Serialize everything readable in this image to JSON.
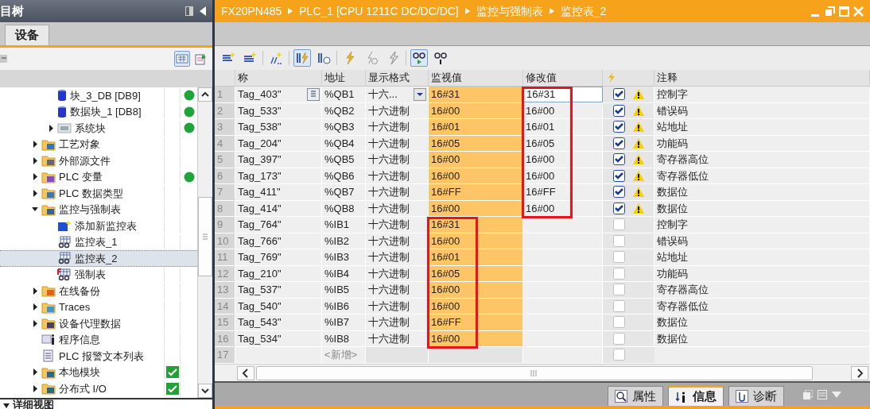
{
  "project_tree": {
    "title": "目树",
    "tab": "设备",
    "toolbar": [
      {
        "kind": "grid-view",
        "pressed": true
      },
      {
        "kind": "export",
        "pressed": false
      }
    ],
    "items": [
      {
        "kind": "hidden-parent",
        "children": [
          {
            "label": "块_3_DB [DB9]",
            "kind": "db",
            "selected": false,
            "online": true
          },
          {
            "label": "数据块_1 [DB8]",
            "kind": "db",
            "selected": false,
            "online": true
          },
          {
            "label": "系统块",
            "kind": "system",
            "expanded": false,
            "selected": false,
            "online": true
          }
        ]
      },
      {
        "label": "工艺对象",
        "kind": "folder-tech",
        "expanded": false,
        "selected": false
      },
      {
        "label": "外部源文件",
        "kind": "folder-source",
        "expanded": false,
        "selected": false
      },
      {
        "label": "PLC 变量",
        "kind": "folder-tags",
        "expanded": false,
        "selected": false,
        "online": true
      },
      {
        "label": "PLC 数据类型",
        "kind": "folder-types",
        "expanded": false,
        "selected": false
      },
      {
        "label": "监控与强制表",
        "kind": "folder-watch",
        "expanded": true,
        "selected": false,
        "children": [
          {
            "label": "添加新监控表",
            "kind": "add",
            "selected": false
          },
          {
            "label": "监控表_1",
            "kind": "watch",
            "selected": false
          },
          {
            "label": "监控表_2",
            "kind": "watch",
            "selected": true
          },
          {
            "label": "强制表",
            "kind": "force",
            "selected": false
          }
        ]
      },
      {
        "label": "在线备份",
        "kind": "folder-backup",
        "expanded": false,
        "selected": false
      },
      {
        "label": "Traces",
        "kind": "folder-trace",
        "expanded": false,
        "selected": false
      },
      {
        "label": "设备代理数据",
        "kind": "folder-proxy",
        "expanded": false,
        "selected": false
      },
      {
        "label": "程序信息",
        "kind": "info",
        "selected": false
      },
      {
        "label": "PLC 报警文本列表",
        "kind": "textlist",
        "selected": false
      },
      {
        "label": "本地模块",
        "kind": "folder-module",
        "expanded": false,
        "selected": false,
        "ok": true
      },
      {
        "label": "分布式 I/O",
        "kind": "folder-module",
        "expanded": false,
        "selected": false,
        "ok": true
      }
    ],
    "detail_view": "详细视图"
  },
  "editor": {
    "breadcrumb": [
      "FX20PN485",
      "PLC_1 [CPU 1211C DC/DC/DC]",
      "监控与强制表",
      "监控表_2"
    ],
    "toolbar": [
      {
        "kind": "insert-row",
        "pressed": false
      },
      {
        "kind": "add-row",
        "pressed": false
      },
      {
        "kind": "multi-row",
        "pressed": false
      },
      {
        "kind": "show-modify",
        "pressed": true
      },
      {
        "kind": "show-trigger",
        "pressed": false
      },
      {
        "kind": "modify-now",
        "pressed": false
      },
      {
        "kind": "modify-trigger",
        "pressed": false
      },
      {
        "kind": "enable-output",
        "pressed": false
      },
      {
        "kind": "monitor-all",
        "pressed": true
      },
      {
        "kind": "monitor-once",
        "pressed": false
      }
    ],
    "columns": [
      "称",
      "地址",
      "显示格式",
      "监视值",
      "修改值",
      "注释"
    ],
    "rows": [
      {
        "no": "1",
        "name": "Tag_403\"",
        "address": "%QB1",
        "format": "十六...",
        "monitor": "16#31",
        "modify": "16#31",
        "editing": true,
        "checked": true,
        "warning": true,
        "comment": "控制字",
        "monitor_framed": false,
        "modify_framed": true
      },
      {
        "no": "2",
        "name": "Tag_533\"",
        "address": "%QB2",
        "format": "十六进制",
        "monitor": "16#00",
        "modify": "16#00",
        "checked": true,
        "warning": true,
        "comment": "错误码",
        "monitor_framed": false,
        "modify_framed": true
      },
      {
        "no": "3",
        "name": "Tag_538\"",
        "address": "%QB3",
        "format": "十六进制",
        "monitor": "16#01",
        "modify": "16#01",
        "checked": true,
        "warning": true,
        "comment": "站地址",
        "monitor_framed": false,
        "modify_framed": true
      },
      {
        "no": "4",
        "name": "Tag_204\"",
        "address": "%QB4",
        "format": "十六进制",
        "monitor": "16#05",
        "modify": "16#05",
        "checked": true,
        "warning": true,
        "comment": "功能码",
        "monitor_framed": false,
        "modify_framed": true
      },
      {
        "no": "5",
        "name": "Tag_397\"",
        "address": "%QB5",
        "format": "十六进制",
        "monitor": "16#00",
        "modify": "16#00",
        "checked": true,
        "warning": true,
        "comment": "寄存器高位",
        "monitor_framed": false,
        "modify_framed": true
      },
      {
        "no": "6",
        "name": "Tag_173\"",
        "address": "%QB6",
        "format": "十六进制",
        "monitor": "16#00",
        "modify": "16#00",
        "checked": true,
        "warning": true,
        "comment": "寄存器低位",
        "monitor_framed": false,
        "modify_framed": true
      },
      {
        "no": "7",
        "name": "Tag_411\"",
        "address": "%QB7",
        "format": "十六进制",
        "monitor": "16#FF",
        "modify": "16#FF",
        "checked": true,
        "warning": true,
        "comment": "数据位",
        "monitor_framed": false,
        "modify_framed": true
      },
      {
        "no": "8",
        "name": "Tag_414\"",
        "address": "%QB8",
        "format": "十六进制",
        "monitor": "16#00",
        "modify": "16#00",
        "checked": true,
        "warning": true,
        "comment": "数据位",
        "monitor_framed": false,
        "modify_framed": true
      },
      {
        "no": "9",
        "name": "Tag_764\"",
        "address": "%IB1",
        "format": "十六进制",
        "monitor": "16#31",
        "checked": false,
        "warning": false,
        "comment": "控制字",
        "monitor_framed": true,
        "modify_framed": false
      },
      {
        "no": "10",
        "name": "Tag_766\"",
        "address": "%IB2",
        "format": "十六进制",
        "monitor": "16#00",
        "checked": false,
        "warning": false,
        "comment": "错误码",
        "monitor_framed": true,
        "modify_framed": false
      },
      {
        "no": "11",
        "name": "Tag_769\"",
        "address": "%IB3",
        "format": "十六进制",
        "monitor": "16#01",
        "checked": false,
        "warning": false,
        "comment": "站地址",
        "monitor_framed": true,
        "modify_framed": false
      },
      {
        "no": "12",
        "name": "Tag_210\"",
        "address": "%IB4",
        "format": "十六进制",
        "monitor": "16#05",
        "checked": false,
        "warning": false,
        "comment": "功能码",
        "monitor_framed": true,
        "modify_framed": false
      },
      {
        "no": "13",
        "name": "Tag_537\"",
        "address": "%IB5",
        "format": "十六进制",
        "monitor": "16#00",
        "checked": false,
        "warning": false,
        "comment": "寄存器高位",
        "monitor_framed": true,
        "modify_framed": false
      },
      {
        "no": "14",
        "name": "Tag_540\"",
        "address": "%IB6",
        "format": "十六进制",
        "monitor": "16#00",
        "checked": false,
        "warning": false,
        "comment": "寄存器低位",
        "monitor_framed": true,
        "modify_framed": false
      },
      {
        "no": "15",
        "name": "Tag_543\"",
        "address": "%IB7",
        "format": "十六进制",
        "monitor": "16#FF",
        "checked": false,
        "warning": false,
        "comment": "数据位",
        "monitor_framed": true,
        "modify_framed": false
      },
      {
        "no": "16",
        "name": "Tag_534\"",
        "address": "%IB8",
        "format": "十六进制",
        "monitor": "16#00",
        "checked": false,
        "warning": false,
        "comment": "数据位",
        "monitor_framed": true,
        "modify_framed": false
      }
    ],
    "new_row": {
      "no": "17",
      "address": "<新增>",
      "checked": false
    },
    "bottom_tabs": [
      {
        "label": "属性",
        "kind": "properties",
        "selected": false
      },
      {
        "label": "信息",
        "kind": "info",
        "selected": true
      },
      {
        "label": "诊断",
        "kind": "diagnostics",
        "selected": false
      }
    ]
  }
}
